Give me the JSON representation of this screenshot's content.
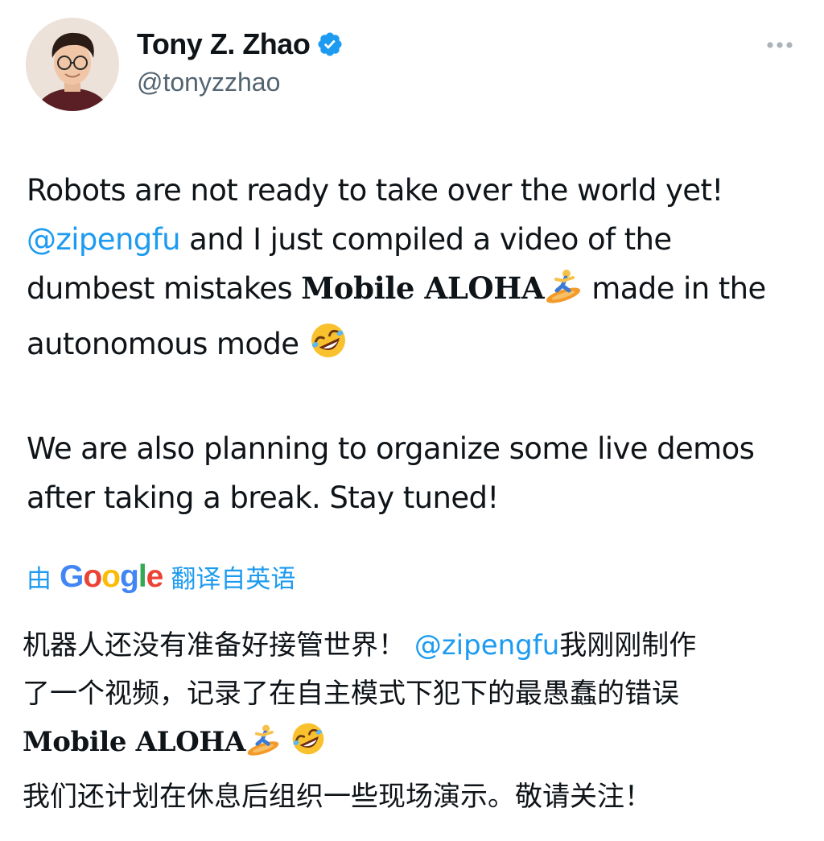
{
  "author": {
    "display_name": "Tony Z. Zhao",
    "handle": "@tonyzzhao",
    "verified": true
  },
  "tweet": {
    "p1": {
      "part1": "Robots are not ready to take over the world yet!",
      "mention": "@zipengfu",
      "part2": " and I just compiled a video of the dumbest mistakes ",
      "bold": "Mobile ALOHA",
      "part3": " made in the autonomous mode "
    },
    "p2": "We are also planning to organize some live demos after taking a break. Stay tuned!"
  },
  "translation": {
    "prefix": "由",
    "brand": "Google",
    "suffix": "翻译自英语",
    "line1_text": "机器人还没有准备好接管世界！ ",
    "line1_mention": "@zipengfu",
    "line1_tail": "我刚刚制作",
    "line2": "了一个视频，记录了在自主模式下犯下的最愚蠢的错误",
    "line3_bold": "Mobile ALOHA",
    "line4": "我们还计划在休息后组织一些现场演示。敬请关注！"
  },
  "icons": {
    "verified": "verified-badge-icon",
    "more": "more-dots-icon",
    "surfer": "person-surfing-emoji",
    "laugh": "rolling-on-floor-laughing-emoji"
  },
  "colors": {
    "accent": "#1d9bf0",
    "text": "#0f1419",
    "secondary": "#536471"
  }
}
